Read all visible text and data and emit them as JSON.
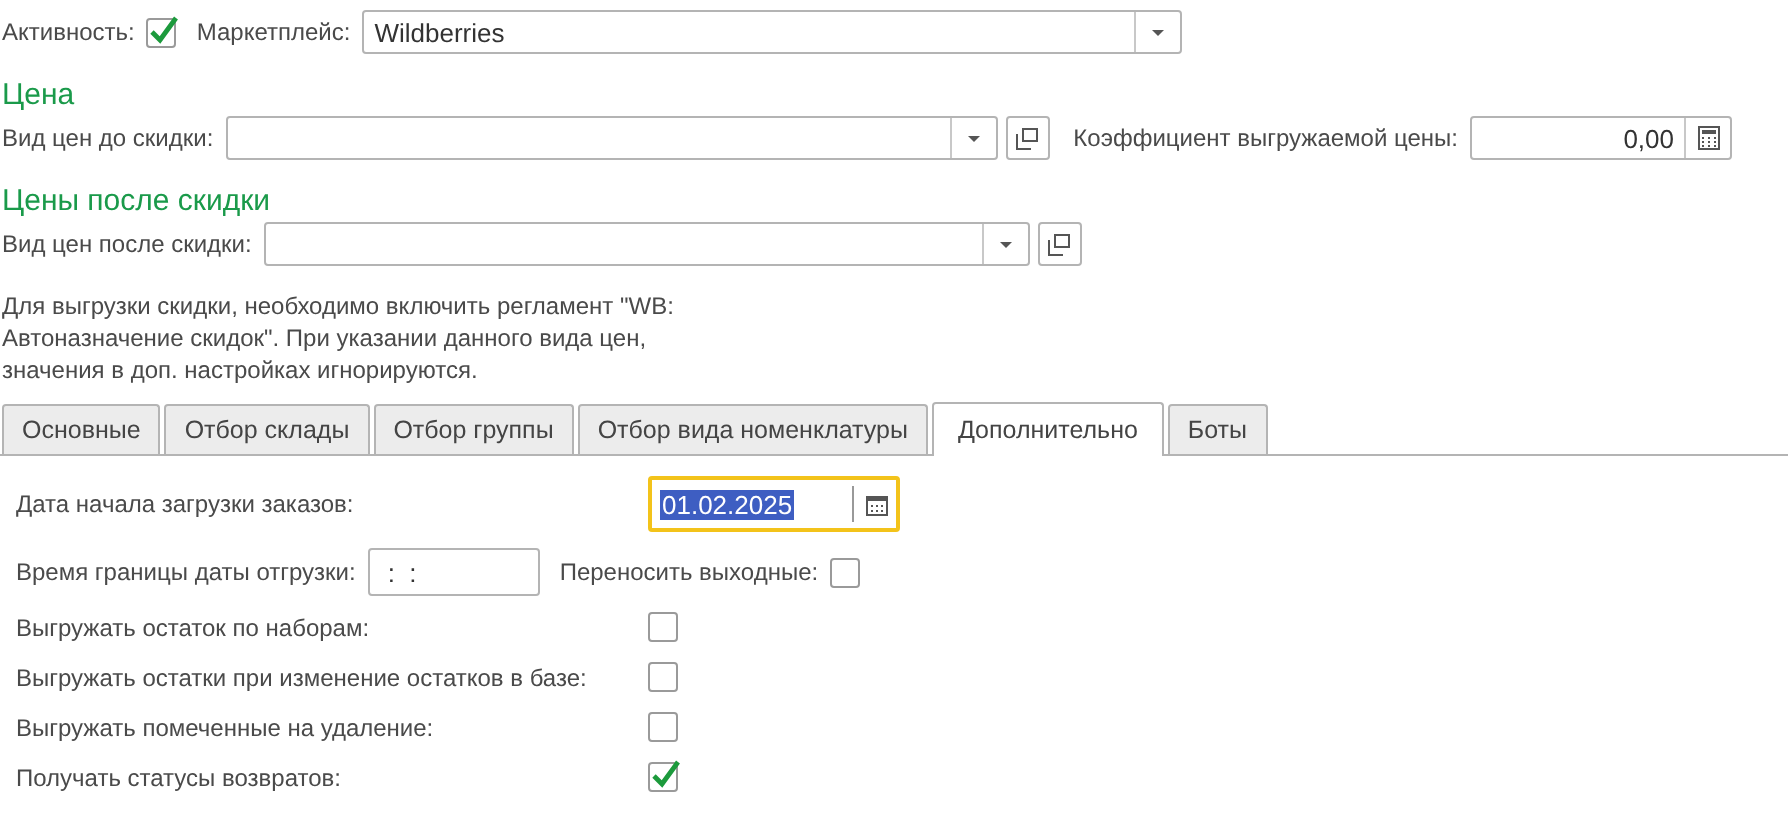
{
  "activity": {
    "label": "Активность:",
    "checked": true
  },
  "marketplace": {
    "label": "Маркетплейс:",
    "value": "Wildberries"
  },
  "price_section": {
    "title": "Цена",
    "price_type": {
      "label": "Вид цен до скидки:"
    },
    "coefficient": {
      "label": "Коэффициент выгружаемой цены:",
      "value": "0,00"
    }
  },
  "discount_section": {
    "title": "Цены после скидки",
    "price_type": {
      "label": "Вид цен после скидки:"
    },
    "note": "Для выгрузки скидки, необходимо включить регламент \"WB:\nАвтоназначение скидок\". При указании данного вида цен,\nзначения в доп. настройках игнорируются."
  },
  "tabs": [
    {
      "label": "Основные",
      "selected": false
    },
    {
      "label": "Отбор склады",
      "selected": false
    },
    {
      "label": "Отбор группы",
      "selected": false
    },
    {
      "label": "Отбор вида номенклатуры",
      "selected": false
    },
    {
      "label": "Дополнительно",
      "selected": true
    },
    {
      "label": "Боты",
      "selected": false
    }
  ],
  "settings": [
    {
      "kind": "date",
      "label": "Дата начала загрузки заказов:",
      "value": "01.02.2025"
    },
    {
      "kind": "time",
      "label": "Время границы даты отгрузки:",
      "value": ":  :",
      "extra": {
        "label": "Переносить выходные:",
        "checked": false
      }
    },
    {
      "kind": "checkbox",
      "label": "Выгружать остаток по наборам:",
      "checked": false
    },
    {
      "kind": "checkbox",
      "label": "Выгружать остатки при изменение остатков в базе:",
      "checked": false
    },
    {
      "kind": "checkbox",
      "label": "Выгружать помеченные на удаление:",
      "checked": false
    },
    {
      "kind": "checkbox",
      "label": "Получать статусы возвратов:",
      "checked": true
    }
  ]
}
